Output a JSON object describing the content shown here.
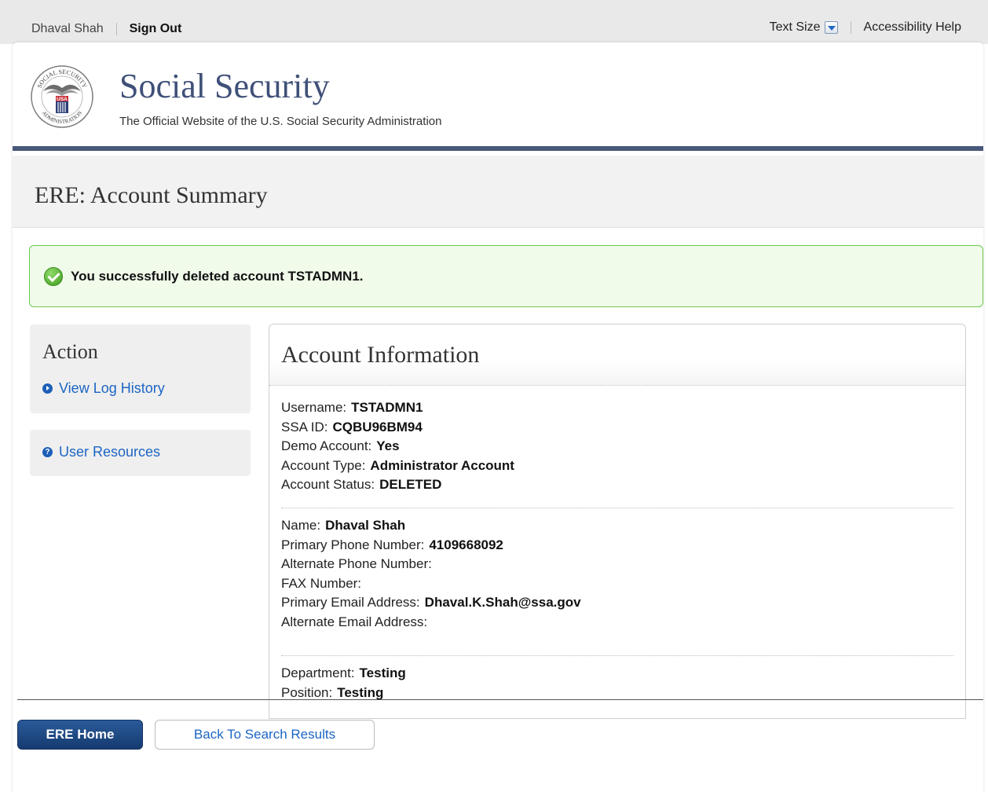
{
  "topbar": {
    "user_name": "Dhaval Shah",
    "sign_out": "Sign Out",
    "text_size": "Text Size",
    "accessibility_help": "Accessibility Help"
  },
  "header": {
    "seal_text_top": "SOCIAL SECURITY",
    "seal_text_mid": "USA",
    "seal_text_bottom": "ADMINISTRATION",
    "title": "Social Security",
    "subtitle": "The Official Website of the U.S. Social Security Administration"
  },
  "page": {
    "title": "ERE: Account Summary"
  },
  "alert": {
    "icon": "check-circle-icon",
    "message": "You successfully deleted account TSTADMN1."
  },
  "sidebar": {
    "action_heading": "Action",
    "view_log_history": "View Log History",
    "user_resources": "User Resources"
  },
  "account": {
    "title": "Account Information",
    "group1": [
      {
        "label": "Username:",
        "value": "TSTADMN1"
      },
      {
        "label": "SSA ID:",
        "value": "CQBU96BM94"
      },
      {
        "label": "Demo Account:",
        "value": "Yes"
      },
      {
        "label": "Account Type:",
        "value": "Administrator Account"
      },
      {
        "label": "Account Status:",
        "value": "DELETED"
      }
    ],
    "group2": [
      {
        "label": "Name:",
        "value": "Dhaval Shah"
      },
      {
        "label": "Primary Phone Number:",
        "value": "4109668092"
      },
      {
        "label": "Alternate Phone Number:",
        "value": ""
      },
      {
        "label": "FAX Number:",
        "value": ""
      },
      {
        "label": "Primary Email Address:",
        "value": "Dhaval.K.Shah@ssa.gov"
      },
      {
        "label": "Alternate Email Address:",
        "value": ""
      }
    ],
    "group3": [
      {
        "label": "Department:",
        "value": "Testing"
      },
      {
        "label": "Position:",
        "value": "Testing"
      }
    ]
  },
  "buttons": {
    "ere_home": "ERE Home",
    "back_to_results": "Back To Search Results"
  },
  "colors": {
    "brand_blue": "#3f5078",
    "header_rule": "#48587a",
    "link": "#1c65c4",
    "success_border": "#6fc94f",
    "success_bg": "#f0fbea"
  }
}
